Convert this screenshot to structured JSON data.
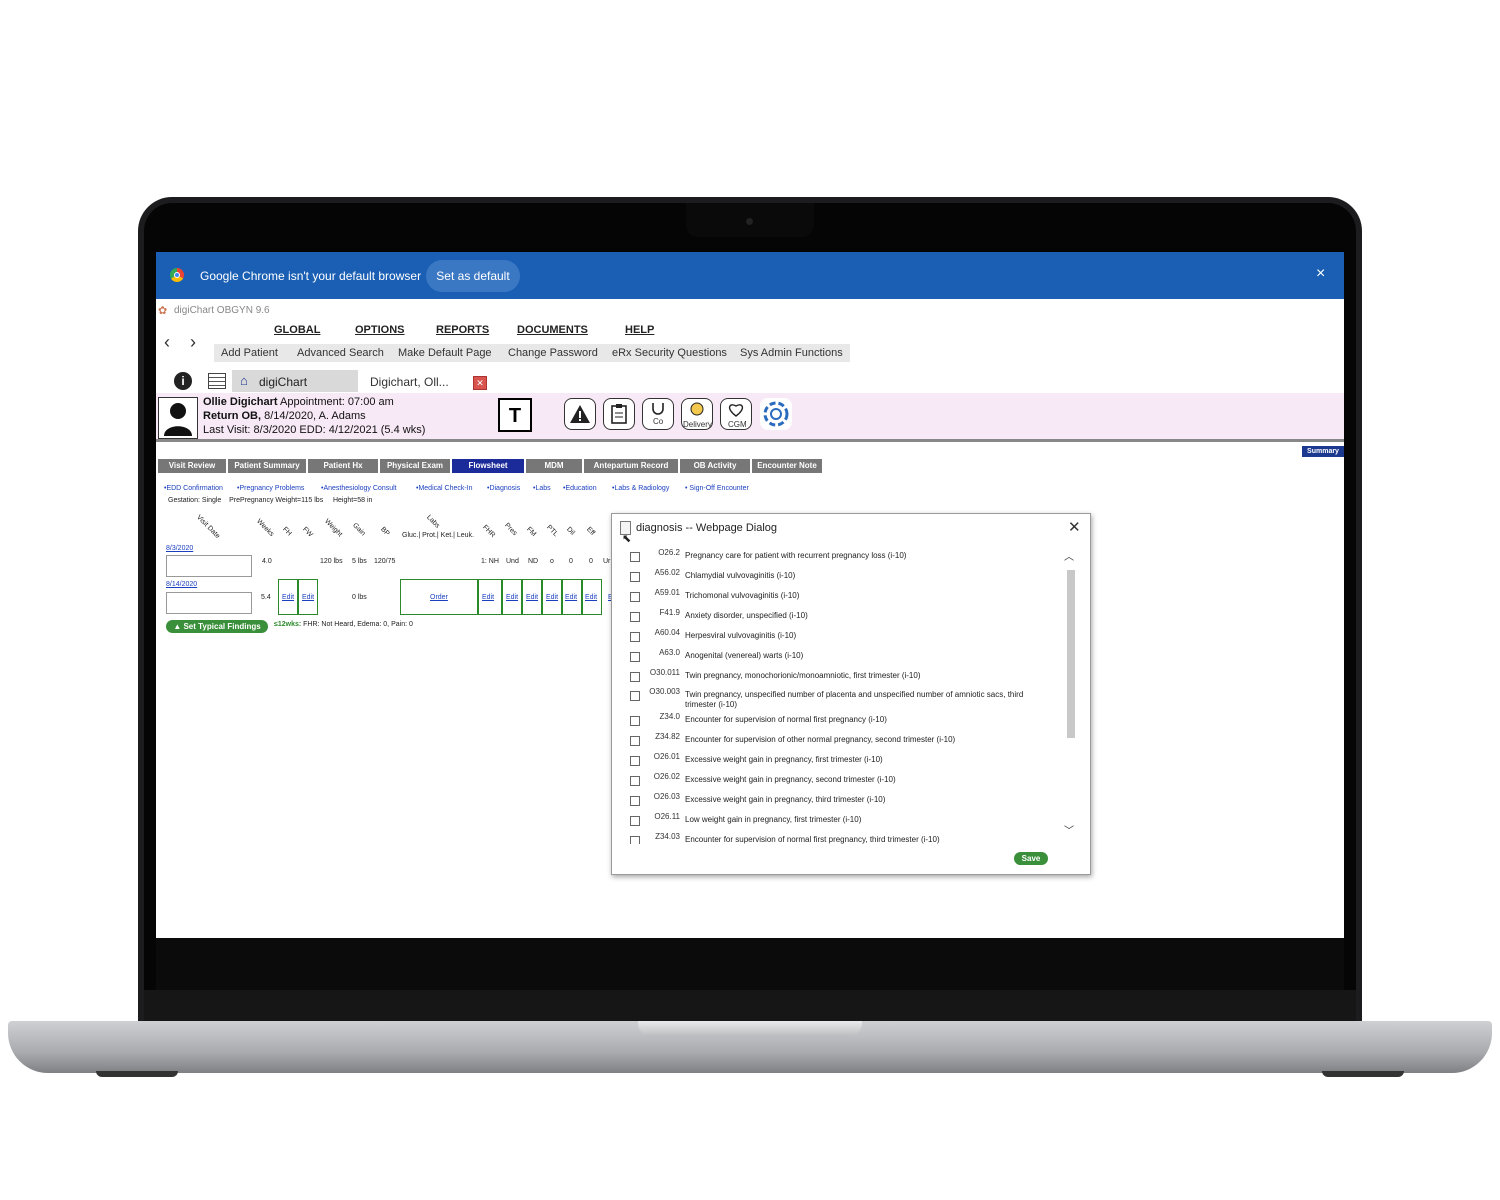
{
  "chrome_banner": {
    "message": "Google Chrome isn't your default browser",
    "set_default": "Set as default",
    "close": "×"
  },
  "app": {
    "title": "digiChart OBGYN 9.6",
    "menu": [
      "GLOBAL",
      "OPTIONS",
      "REPORTS",
      "DOCUMENTS",
      "HELP"
    ],
    "submenu": [
      "Add Patient",
      "Advanced Search",
      "Make Default Page",
      "Change Password",
      "eRx Security Questions",
      "Sys Admin Functions"
    ],
    "tabs": {
      "home": "digiChart",
      "doc": "Digichart, Oll..."
    }
  },
  "patient": {
    "name": "Ollie Digichart",
    "appointment": "Appointment: 07:00 am",
    "visit_type": "Return OB,",
    "visit_info": "8/14/2020, A. Adams",
    "last_visit": "Last Visit: 8/3/2020  EDD: 4/12/2021 (5.4 wks)"
  },
  "toolbar": {
    "t_label": "T",
    "delivery": "Delivery",
    "cgm": "CGM",
    "co": "Co"
  },
  "summary_btn": "Summary",
  "flow_tabs": [
    "Visit Review",
    "Patient Summary",
    "Patient Hx",
    "Physical Exam",
    "Flowsheet",
    "MDM",
    "Antepartum Record",
    "OB Activity",
    "Encounter Note"
  ],
  "active_tab": "Flowsheet",
  "quick_links": [
    "•EDD Confirmation",
    "•Pregnancy Problems",
    "•Anesthesiology Consult",
    "•Medical Check-In",
    "•Diagnosis",
    "•Labs",
    "•Education",
    "•Labs & Radiology",
    "• Sign-Off Encounter"
  ],
  "gestation": {
    "gest": "Gestation: Single",
    "pre_weight": "PrePregnancy Weight=115 lbs",
    "height": "Height=58 in"
  },
  "flow_headers": [
    "Visit Date",
    "Weeks",
    "FH",
    "FW",
    "Weight",
    "Gain",
    "BP",
    "Labs",
    "FHR",
    "Pres",
    "FM",
    "PTL",
    "Dil",
    "Eff"
  ],
  "labs_sub": "Gluc.| Prot.| Ket.| Leuk.",
  "rows": [
    {
      "date": "8/3/2020",
      "weeks": "4.0",
      "weight": "120 lbs",
      "gain": "5 lbs",
      "bp": "120/75",
      "fhr": "1: NH",
      "pres": "Und",
      "fm": "ND",
      "ptl": "o",
      "dil": "0",
      "eff": "0",
      "more": "Ur"
    },
    {
      "date": "8/14/2020",
      "weeks": "5.4",
      "fh": "Edit",
      "fw": "Edit",
      "gain": "0 lbs",
      "labs": "Order",
      "fhr": "Edit",
      "pres": "Edit",
      "fm": "Edit",
      "ptl": "Edit",
      "dil": "Edit",
      "eff": "Edit",
      "more": "E"
    }
  ],
  "findings": {
    "button": "▲ Set Typical Findings",
    "label": "≤12wks:",
    "text": "FHR: Not Heard, Edema: 0, Pain: 0"
  },
  "dialog": {
    "title": "diagnosis -- Webpage Dialog",
    "close": "✕",
    "save": "Save",
    "items": [
      {
        "code": "O26.2",
        "desc": "Pregnancy care for patient with recurrent pregnancy loss (i-10)"
      },
      {
        "code": "A56.02",
        "desc": "Chlamydial vulvovaginitis (i-10)"
      },
      {
        "code": "A59.01",
        "desc": "Trichomonal vulvovaginitis (i-10)"
      },
      {
        "code": "F41.9",
        "desc": "Anxiety disorder, unspecified (i-10)"
      },
      {
        "code": "A60.04",
        "desc": "Herpesviral vulvovaginitis (i-10)"
      },
      {
        "code": "A63.0",
        "desc": "Anogenital (venereal) warts (i-10)"
      },
      {
        "code": "O30.011",
        "desc": "Twin pregnancy, monochorionic/monoamniotic, first trimester (i-10)"
      },
      {
        "code": "O30.003",
        "desc": "Twin pregnancy, unspecified number of placenta and unspecified number of amniotic sacs, third trimester (i-10)"
      },
      {
        "code": "Z34.0",
        "desc": "Encounter for supervision of normal first pregnancy (i-10)"
      },
      {
        "code": "Z34.82",
        "desc": "Encounter for supervision of other normal pregnancy, second trimester (i-10)"
      },
      {
        "code": "O26.01",
        "desc": "Excessive weight gain in pregnancy, first trimester (i-10)"
      },
      {
        "code": "O26.02",
        "desc": "Excessive weight gain in pregnancy, second trimester (i-10)"
      },
      {
        "code": "O26.03",
        "desc": "Excessive weight gain in pregnancy, third trimester (i-10)"
      },
      {
        "code": "O26.11",
        "desc": "Low weight gain in pregnancy, first trimester (i-10)"
      },
      {
        "code": "Z34.03",
        "desc": "Encounter for supervision of normal first pregnancy, third trimester (i-10)"
      }
    ]
  },
  "colors": {
    "chrome_blue": "#1a5fb4",
    "tab_active": "#1b2b9a",
    "tab": "#777777",
    "patient_band": "#f7e9f6",
    "green": "#3a8f3a",
    "link": "#1a3fbf"
  }
}
